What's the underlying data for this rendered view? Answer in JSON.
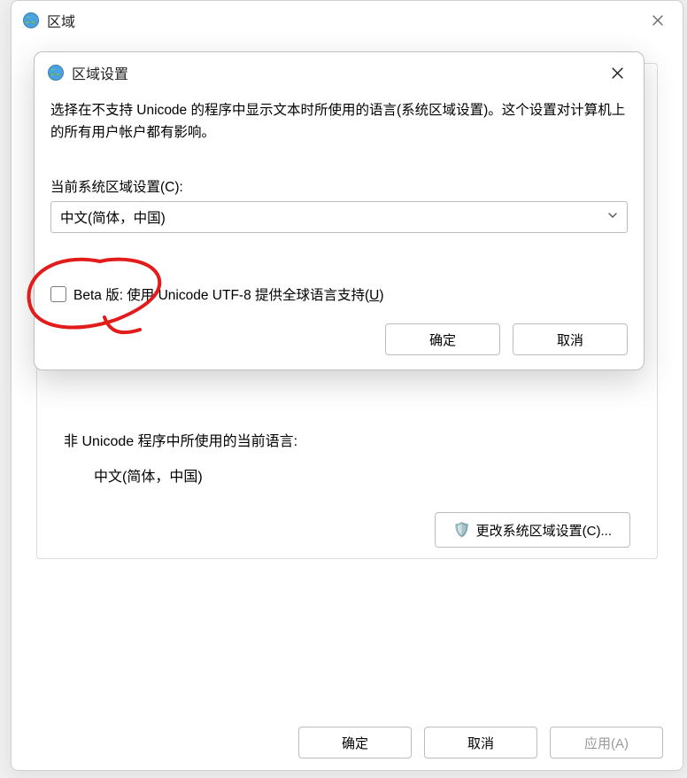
{
  "parent": {
    "title": "区域",
    "group": {
      "section_label": "非 Unicode 程序中所使用的当前语言:",
      "section_value": "中文(简体，中国)",
      "change_button": "更改系统区域设置(C)..."
    },
    "footer": {
      "ok": "确定",
      "cancel": "取消",
      "apply": "应用(A)"
    }
  },
  "modal": {
    "title": "区域设置",
    "description": "选择在不支持 Unicode 的程序中显示文本时所使用的语言(系统区域设置)。这个设置对计算机上的所有用户帐户都有影响。",
    "current_label": "当前系统区域设置(C):",
    "select_value": "中文(简体，中国)",
    "checkbox_label_prefix": "Beta 版: 使用 Unicode UTF-8 提供全球语言支持(",
    "checkbox_label_key": "U",
    "checkbox_label_suffix": ")",
    "footer": {
      "ok": "确定",
      "cancel": "取消"
    }
  }
}
